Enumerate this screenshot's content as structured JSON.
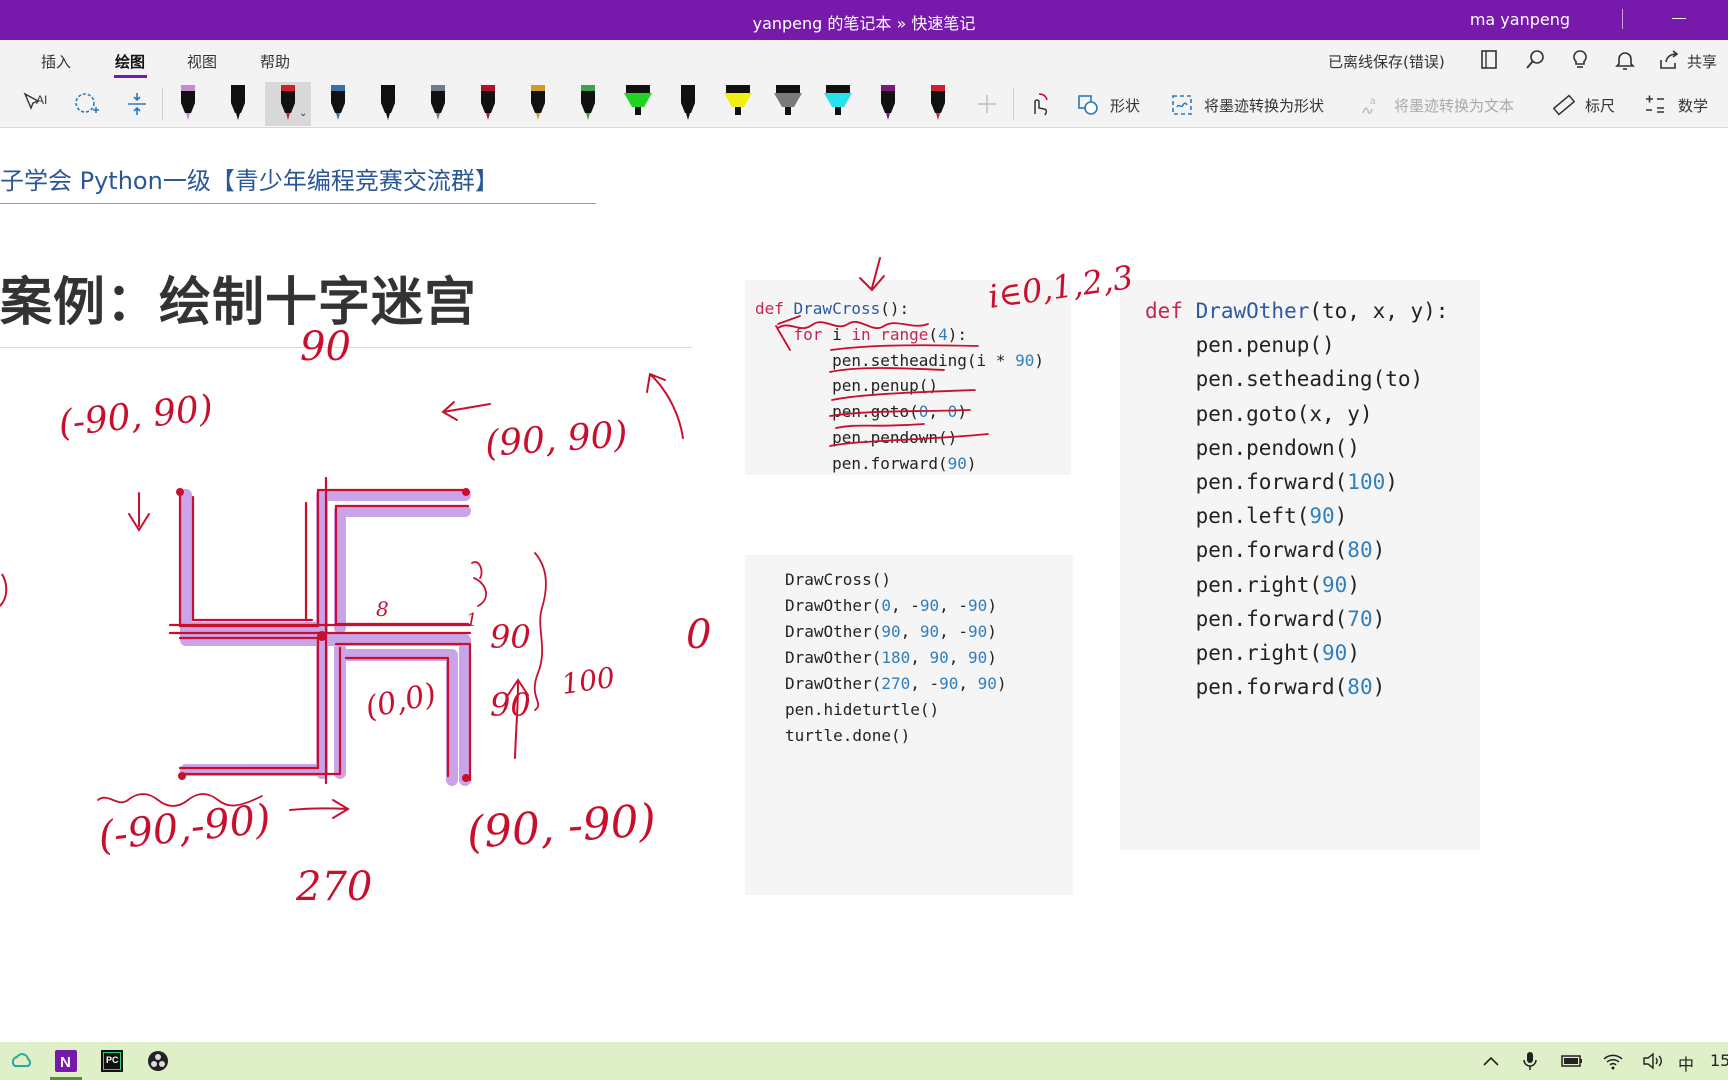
{
  "window": {
    "title": "yanpeng 的笔记本 » 快速笔记",
    "user": "ma yanpeng"
  },
  "menu": {
    "tabs": [
      "插入",
      "绘图",
      "视图",
      "帮助"
    ],
    "active_tab": "绘图",
    "save_status": "已离线保存(错误)",
    "share": "共享"
  },
  "toolbar": {
    "shapes": "形状",
    "ink_to_shape": "将墨迹转换为形状",
    "ink_to_text": "将墨迹转换为文本",
    "ruler": "标尺",
    "math": "数学",
    "pens": [
      {
        "name": "pen-purple-highlighter",
        "color": "#c48bd0"
      },
      {
        "name": "pen-black",
        "color": "#111111"
      },
      {
        "name": "pen-red-selected",
        "color": "#d0202e"
      },
      {
        "name": "pen-blue-gray",
        "color": "#3a6ea5"
      },
      {
        "name": "pen-black-wide",
        "color": "#111111"
      },
      {
        "name": "pen-galaxy",
        "color": "#6f7a8a"
      },
      {
        "name": "pen-dark-red",
        "color": "#b0102a"
      },
      {
        "name": "pen-gold",
        "color": "#d09a2a"
      },
      {
        "name": "pen-rainbow",
        "color": "#3fa34d"
      },
      {
        "name": "highlighter-green",
        "color": "#22d322"
      },
      {
        "name": "pen-zigzag-black",
        "color": "#111111"
      },
      {
        "name": "highlighter-yellow",
        "color": "#f0ef14"
      },
      {
        "name": "highlighter-gray",
        "color": "#7a7a7a"
      },
      {
        "name": "highlighter-cyan",
        "color": "#26e2ea"
      },
      {
        "name": "pen-zigzag-purple",
        "color": "#7a1a7a"
      },
      {
        "name": "pen-red",
        "color": "#d0202e"
      }
    ]
  },
  "page": {
    "title": "子学会 Python一级【青少年编程竞赛交流群】",
    "heading": "案例：绘制十字迷宫"
  },
  "code1": [
    "def DrawCross():",
    "    for i in range(4):",
    "        pen.setheading(i * 90)",
    "        pen.penup()",
    "        pen.goto(0, 0)",
    "        pen.pendown()",
    "        pen.forward(90)"
  ],
  "code2": [
    "DrawCross()",
    "DrawOther(0, -90, -90)",
    "DrawOther(90, 90, -90)",
    "DrawOther(180, 90, 90)",
    "DrawOther(270, -90, 90)",
    "pen.hideturtle()",
    "turtle.done()"
  ],
  "code3": [
    "def DrawOther(to, x, y):",
    "    pen.penup()",
    "    pen.setheading(to)",
    "    pen.goto(x, y)",
    "    pen.pendown()",
    "    pen.forward(100)",
    "    pen.left(90)",
    "    pen.forward(80)",
    "    pen.right(90)",
    "    pen.forward(70)",
    "    pen.right(90)",
    "    pen.forward(80)"
  ],
  "annotations": {
    "a90_top": "90",
    "point_tl": "(-90, 90)",
    "point_tr": "(90, 90)",
    "point_bl": "(-90,-90)",
    "point_br": "(90, -90)",
    "origin": "(0,0)",
    "a90_right1": "90",
    "a90_right2": "90",
    "a100": "100",
    "a270": "270",
    "i_range": "i∈0,1,2,3",
    "zero": "0",
    "eighty": "8"
  },
  "taskbar": {
    "ime": "中",
    "clock": "15"
  },
  "colors": {
    "titlebar": "#7719aa",
    "ink_red": "#c8102e",
    "ink_purple": "#9b59d0"
  }
}
